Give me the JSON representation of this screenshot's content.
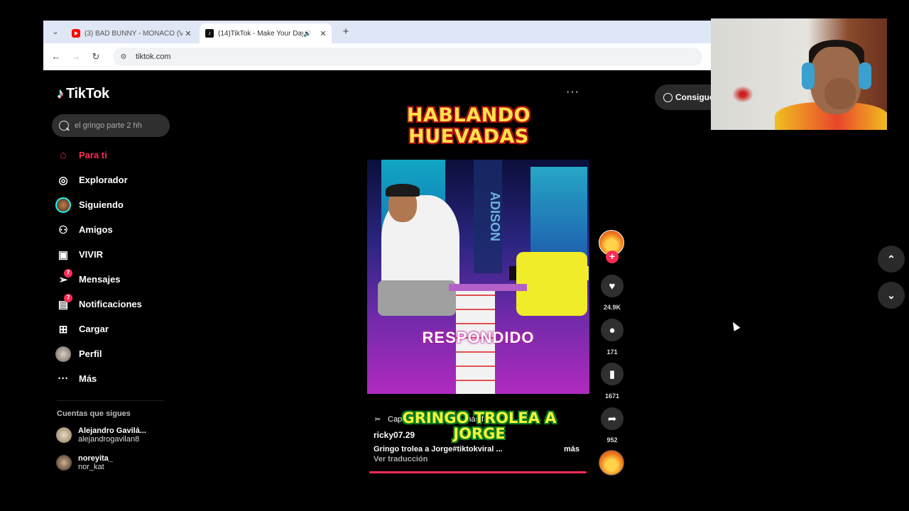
{
  "browser": {
    "tabs": [
      {
        "title": "(3) BAD BUNNY - MONACO (Vi",
        "icon": "youtube-icon",
        "active": false
      },
      {
        "title": "(14)TikTok - Make Your Day",
        "icon": "tiktok-icon",
        "active": true
      }
    ],
    "address": "tiktok.com",
    "glyphs": {
      "menu": "⌄",
      "close": "✕",
      "audio": "🔊",
      "new_tab": "+",
      "back": "←",
      "forward": "→",
      "reload": "↻",
      "site_info": "⚙"
    }
  },
  "tiktok": {
    "logo_text": "TikTok",
    "search_placeholder": "el gringo parte 2 hh",
    "nav": [
      {
        "label": "Para ti",
        "icon": "home-icon",
        "glyph": "⌂",
        "active": true,
        "badge": ""
      },
      {
        "label": "Explorador",
        "icon": "compass-icon",
        "glyph": "◎",
        "active": false,
        "badge": ""
      },
      {
        "label": "Siguiendo",
        "icon": "following-avatar-icon",
        "glyph": "",
        "active": false,
        "badge": ""
      },
      {
        "label": "Amigos",
        "icon": "friends-icon",
        "glyph": "⚇",
        "active": false,
        "badge": ""
      },
      {
        "label": "VIVIR",
        "icon": "live-tv-icon",
        "glyph": "▣",
        "active": false,
        "badge": ""
      },
      {
        "label": "Mensajes",
        "icon": "messages-icon",
        "glyph": "➢",
        "active": false,
        "badge": "7"
      },
      {
        "label": "Notificaciones",
        "icon": "notifications-icon",
        "glyph": "▤",
        "active": false,
        "badge": "7"
      },
      {
        "label": "Cargar",
        "icon": "upload-icon",
        "glyph": "⊞",
        "active": false,
        "badge": ""
      },
      {
        "label": "Perfil",
        "icon": "profile-avatar-icon",
        "glyph": "",
        "active": false,
        "badge": ""
      },
      {
        "label": "Más",
        "icon": "more-icon",
        "glyph": "···",
        "active": false,
        "badge": ""
      }
    ],
    "following_title": "Cuentas que sigues",
    "following": [
      {
        "name": "Alejandro Gavilá...",
        "handle": "alejandrogavilan8"
      },
      {
        "name": "noreyita_",
        "handle": "nor_kat"
      }
    ],
    "get_app": "Consigue",
    "video": {
      "headline": "HABLANDO HUEVADAS",
      "overlay_stamp": "RESPONDIDO",
      "overlay_caption": "GRINGO TROLEA A JORGE",
      "capcut_label": "CapCut · Una edición más fácil",
      "author": "ricky07.29",
      "description": "Gringo trolea a Jorge#tiktokviral  ...",
      "more": "más",
      "translate": "Ver traducción",
      "menu": "···"
    },
    "actions": {
      "follow_plus": "+",
      "likes": "24.9K",
      "comments": "171",
      "saves": "1671",
      "shares": "952",
      "glyphs": {
        "like": "♥",
        "comment": "●",
        "save": "▮",
        "share": "➦"
      }
    },
    "arrows": {
      "up": "⌃",
      "down": "⌄"
    }
  }
}
